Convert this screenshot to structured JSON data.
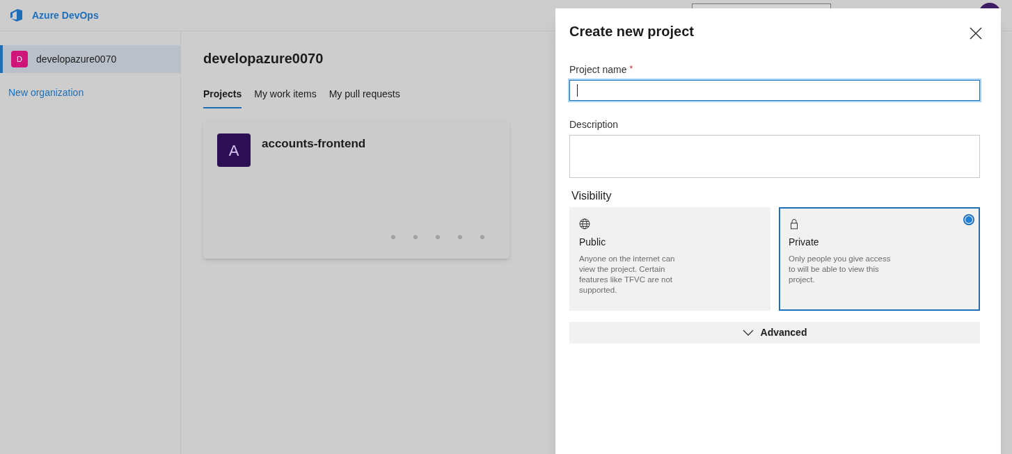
{
  "header": {
    "product": "Azure DevOps"
  },
  "sidebar": {
    "items": [
      {
        "initial": "D",
        "label": "developazure0070",
        "selected": true
      }
    ],
    "link": "New organization"
  },
  "main": {
    "title": "developazure0070",
    "tabs": [
      {
        "label": "Projects",
        "selected": true
      },
      {
        "label": "My work items",
        "selected": false
      },
      {
        "label": "My pull requests",
        "selected": false
      }
    ],
    "projects": [
      {
        "initial": "A",
        "name": "accounts-frontend"
      }
    ]
  },
  "dialog": {
    "title": "Create new project",
    "fields": [
      {
        "label": "Project name",
        "required_mark": "*",
        "focused": true,
        "kind": "input"
      },
      {
        "label": "Description",
        "focused": false,
        "kind": "textarea"
      }
    ],
    "visibility_label": "Visibility",
    "options": [
      {
        "kind": "public",
        "title": "Public",
        "description": "Anyone on the internet can view the project. Certain features like TFVC are not supported.",
        "selected": false
      },
      {
        "kind": "private",
        "title": "Private",
        "description": "Only people you give access to will be able to view this project.",
        "selected": true
      }
    ],
    "advanced": {
      "label": "Advanced",
      "expanded": false
    }
  }
}
